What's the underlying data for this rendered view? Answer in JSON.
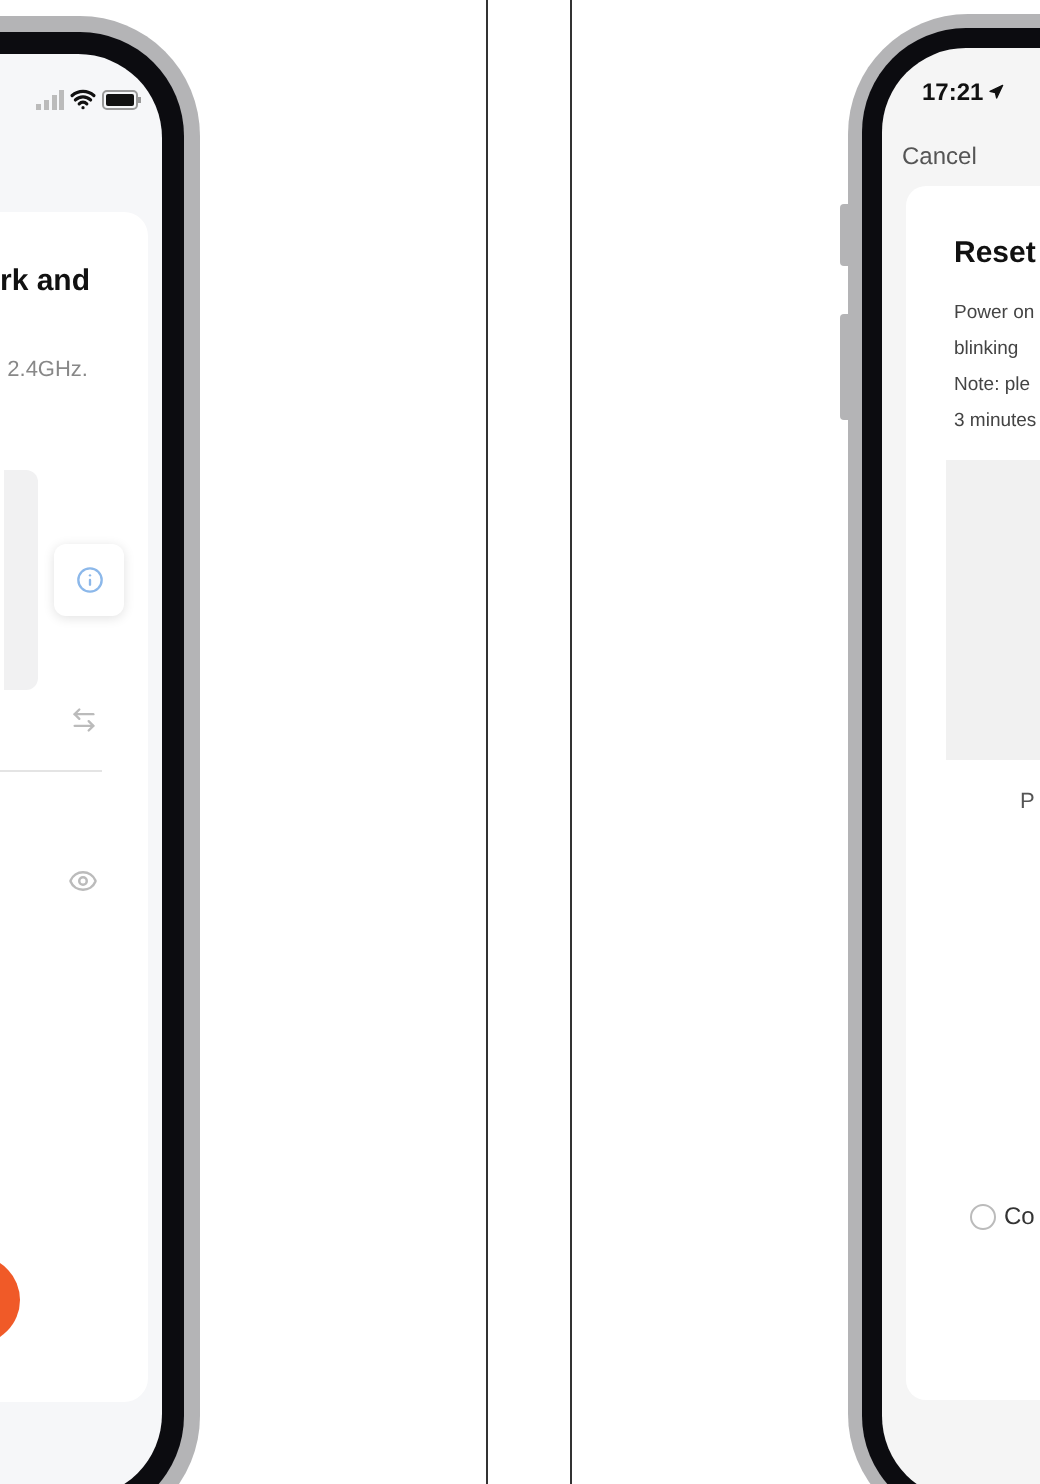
{
  "left_phone": {
    "title": "rk and",
    "subtitle": "2.4GHz."
  },
  "right_phone": {
    "status_time": "17:21",
    "cancel": "Cancel",
    "title": "Reset",
    "instructions": [
      "Power on",
      "blinking",
      "Note: ple",
      "3 minutes"
    ],
    "image_caption": "P",
    "agreement": {
      "label": "Co",
      "checked": false
    }
  }
}
